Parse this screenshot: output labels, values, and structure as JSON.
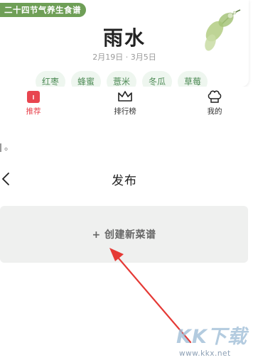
{
  "card": {
    "tag": "二十四节气养生食谱",
    "term": "雨水",
    "dates": "2月19日 · 3月5日",
    "chips": [
      "红枣",
      "蜂蜜",
      "薏米",
      "冬瓜",
      "草莓"
    ]
  },
  "tabbar": {
    "tabs": [
      {
        "label": "推荐",
        "icon": "recommend-icon",
        "active": true
      },
      {
        "label": "排行榜",
        "icon": "crown-icon"
      },
      {
        "label": "我的",
        "icon": "chef-hat-icon"
      }
    ]
  },
  "content": {
    "dot_text": "。",
    "page_title": "发布",
    "create_label": "+ 创建新菜谱"
  },
  "watermark": {
    "logo": "KK下载",
    "url": "www.kkx.net"
  },
  "colors": {
    "accent": "#e8454f",
    "tag_green": "#6f9f57",
    "chip_bg": "#eef6ef",
    "arrow": "#e53935"
  }
}
